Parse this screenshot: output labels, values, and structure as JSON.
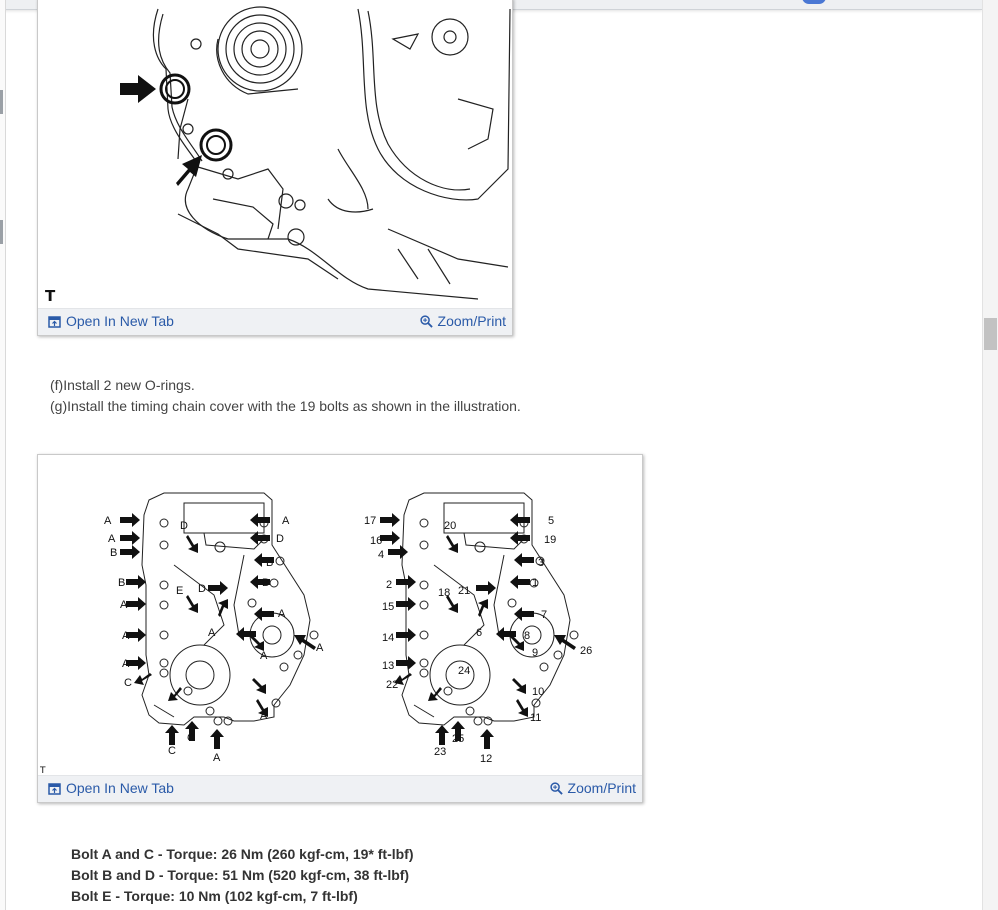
{
  "figure1": {
    "marker": "T",
    "open_label": "Open In New Tab",
    "zoom_label": "Zoom/Print"
  },
  "instructions": [
    "(f)Install 2 new O-rings.",
    "(g)Install the timing chain cover with the 19 bolts as shown in the illustration."
  ],
  "figure2": {
    "marker": "T",
    "open_label": "Open In New Tab",
    "zoom_label": "Zoom/Print",
    "left_labels": [
      "A",
      "A",
      "B",
      "B",
      "A",
      "A",
      "A",
      "C",
      "D",
      "E",
      "D",
      "A",
      "A",
      "A",
      "A",
      "A",
      "B",
      "B",
      "D",
      "A",
      "C",
      "C",
      "A"
    ],
    "right_labels": [
      "17",
      "16",
      "4",
      "2",
      "15",
      "14",
      "13",
      "22",
      "20",
      "18",
      "21",
      "6",
      "8",
      "9",
      "10",
      "11",
      "12",
      "25",
      "23",
      "24",
      "1",
      "3",
      "5",
      "19",
      "7",
      "26"
    ]
  },
  "torque_specs": [
    "Bolt A and C - Torque: 26 Nm (260 kgf-cm, 19* ft-lbf)",
    "Bolt B and D - Torque: 51 Nm (520 kgf-cm, 38 ft-lbf)",
    "Bolt E - Torque: 10 Nm (102 kgf-cm, 7 ft-lbf)"
  ],
  "icons": {
    "open": "open-in-new-tab-icon",
    "zoom": "magnifier-zoom-icon"
  },
  "colors": {
    "link": "#2a5aa8",
    "bar": "#eff1f4",
    "text": "#444444"
  }
}
